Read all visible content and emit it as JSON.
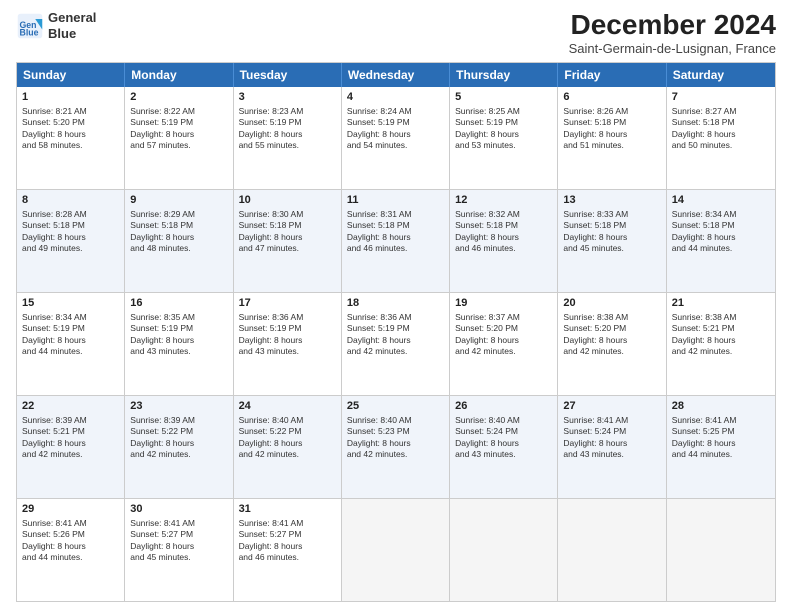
{
  "header": {
    "logo_line1": "General",
    "logo_line2": "Blue",
    "month": "December 2024",
    "location": "Saint-Germain-de-Lusignan, France"
  },
  "weekdays": [
    "Sunday",
    "Monday",
    "Tuesday",
    "Wednesday",
    "Thursday",
    "Friday",
    "Saturday"
  ],
  "weeks": [
    [
      {
        "day": "1",
        "lines": [
          "Sunrise: 8:21 AM",
          "Sunset: 5:20 PM",
          "Daylight: 8 hours",
          "and 58 minutes."
        ],
        "empty": false
      },
      {
        "day": "2",
        "lines": [
          "Sunrise: 8:22 AM",
          "Sunset: 5:19 PM",
          "Daylight: 8 hours",
          "and 57 minutes."
        ],
        "empty": false
      },
      {
        "day": "3",
        "lines": [
          "Sunrise: 8:23 AM",
          "Sunset: 5:19 PM",
          "Daylight: 8 hours",
          "and 55 minutes."
        ],
        "empty": false
      },
      {
        "day": "4",
        "lines": [
          "Sunrise: 8:24 AM",
          "Sunset: 5:19 PM",
          "Daylight: 8 hours",
          "and 54 minutes."
        ],
        "empty": false
      },
      {
        "day": "5",
        "lines": [
          "Sunrise: 8:25 AM",
          "Sunset: 5:19 PM",
          "Daylight: 8 hours",
          "and 53 minutes."
        ],
        "empty": false
      },
      {
        "day": "6",
        "lines": [
          "Sunrise: 8:26 AM",
          "Sunset: 5:18 PM",
          "Daylight: 8 hours",
          "and 51 minutes."
        ],
        "empty": false
      },
      {
        "day": "7",
        "lines": [
          "Sunrise: 8:27 AM",
          "Sunset: 5:18 PM",
          "Daylight: 8 hours",
          "and 50 minutes."
        ],
        "empty": false
      }
    ],
    [
      {
        "day": "8",
        "lines": [
          "Sunrise: 8:28 AM",
          "Sunset: 5:18 PM",
          "Daylight: 8 hours",
          "and 49 minutes."
        ],
        "empty": false
      },
      {
        "day": "9",
        "lines": [
          "Sunrise: 8:29 AM",
          "Sunset: 5:18 PM",
          "Daylight: 8 hours",
          "and 48 minutes."
        ],
        "empty": false
      },
      {
        "day": "10",
        "lines": [
          "Sunrise: 8:30 AM",
          "Sunset: 5:18 PM",
          "Daylight: 8 hours",
          "and 47 minutes."
        ],
        "empty": false
      },
      {
        "day": "11",
        "lines": [
          "Sunrise: 8:31 AM",
          "Sunset: 5:18 PM",
          "Daylight: 8 hours",
          "and 46 minutes."
        ],
        "empty": false
      },
      {
        "day": "12",
        "lines": [
          "Sunrise: 8:32 AM",
          "Sunset: 5:18 PM",
          "Daylight: 8 hours",
          "and 46 minutes."
        ],
        "empty": false
      },
      {
        "day": "13",
        "lines": [
          "Sunrise: 8:33 AM",
          "Sunset: 5:18 PM",
          "Daylight: 8 hours",
          "and 45 minutes."
        ],
        "empty": false
      },
      {
        "day": "14",
        "lines": [
          "Sunrise: 8:34 AM",
          "Sunset: 5:18 PM",
          "Daylight: 8 hours",
          "and 44 minutes."
        ],
        "empty": false
      }
    ],
    [
      {
        "day": "15",
        "lines": [
          "Sunrise: 8:34 AM",
          "Sunset: 5:19 PM",
          "Daylight: 8 hours",
          "and 44 minutes."
        ],
        "empty": false
      },
      {
        "day": "16",
        "lines": [
          "Sunrise: 8:35 AM",
          "Sunset: 5:19 PM",
          "Daylight: 8 hours",
          "and 43 minutes."
        ],
        "empty": false
      },
      {
        "day": "17",
        "lines": [
          "Sunrise: 8:36 AM",
          "Sunset: 5:19 PM",
          "Daylight: 8 hours",
          "and 43 minutes."
        ],
        "empty": false
      },
      {
        "day": "18",
        "lines": [
          "Sunrise: 8:36 AM",
          "Sunset: 5:19 PM",
          "Daylight: 8 hours",
          "and 42 minutes."
        ],
        "empty": false
      },
      {
        "day": "19",
        "lines": [
          "Sunrise: 8:37 AM",
          "Sunset: 5:20 PM",
          "Daylight: 8 hours",
          "and 42 minutes."
        ],
        "empty": false
      },
      {
        "day": "20",
        "lines": [
          "Sunrise: 8:38 AM",
          "Sunset: 5:20 PM",
          "Daylight: 8 hours",
          "and 42 minutes."
        ],
        "empty": false
      },
      {
        "day": "21",
        "lines": [
          "Sunrise: 8:38 AM",
          "Sunset: 5:21 PM",
          "Daylight: 8 hours",
          "and 42 minutes."
        ],
        "empty": false
      }
    ],
    [
      {
        "day": "22",
        "lines": [
          "Sunrise: 8:39 AM",
          "Sunset: 5:21 PM",
          "Daylight: 8 hours",
          "and 42 minutes."
        ],
        "empty": false
      },
      {
        "day": "23",
        "lines": [
          "Sunrise: 8:39 AM",
          "Sunset: 5:22 PM",
          "Daylight: 8 hours",
          "and 42 minutes."
        ],
        "empty": false
      },
      {
        "day": "24",
        "lines": [
          "Sunrise: 8:40 AM",
          "Sunset: 5:22 PM",
          "Daylight: 8 hours",
          "and 42 minutes."
        ],
        "empty": false
      },
      {
        "day": "25",
        "lines": [
          "Sunrise: 8:40 AM",
          "Sunset: 5:23 PM",
          "Daylight: 8 hours",
          "and 42 minutes."
        ],
        "empty": false
      },
      {
        "day": "26",
        "lines": [
          "Sunrise: 8:40 AM",
          "Sunset: 5:24 PM",
          "Daylight: 8 hours",
          "and 43 minutes."
        ],
        "empty": false
      },
      {
        "day": "27",
        "lines": [
          "Sunrise: 8:41 AM",
          "Sunset: 5:24 PM",
          "Daylight: 8 hours",
          "and 43 minutes."
        ],
        "empty": false
      },
      {
        "day": "28",
        "lines": [
          "Sunrise: 8:41 AM",
          "Sunset: 5:25 PM",
          "Daylight: 8 hours",
          "and 44 minutes."
        ],
        "empty": false
      }
    ],
    [
      {
        "day": "29",
        "lines": [
          "Sunrise: 8:41 AM",
          "Sunset: 5:26 PM",
          "Daylight: 8 hours",
          "and 44 minutes."
        ],
        "empty": false
      },
      {
        "day": "30",
        "lines": [
          "Sunrise: 8:41 AM",
          "Sunset: 5:27 PM",
          "Daylight: 8 hours",
          "and 45 minutes."
        ],
        "empty": false
      },
      {
        "day": "31",
        "lines": [
          "Sunrise: 8:41 AM",
          "Sunset: 5:27 PM",
          "Daylight: 8 hours",
          "and 46 minutes."
        ],
        "empty": false
      },
      {
        "day": "",
        "lines": [],
        "empty": true
      },
      {
        "day": "",
        "lines": [],
        "empty": true
      },
      {
        "day": "",
        "lines": [],
        "empty": true
      },
      {
        "day": "",
        "lines": [],
        "empty": true
      }
    ]
  ]
}
